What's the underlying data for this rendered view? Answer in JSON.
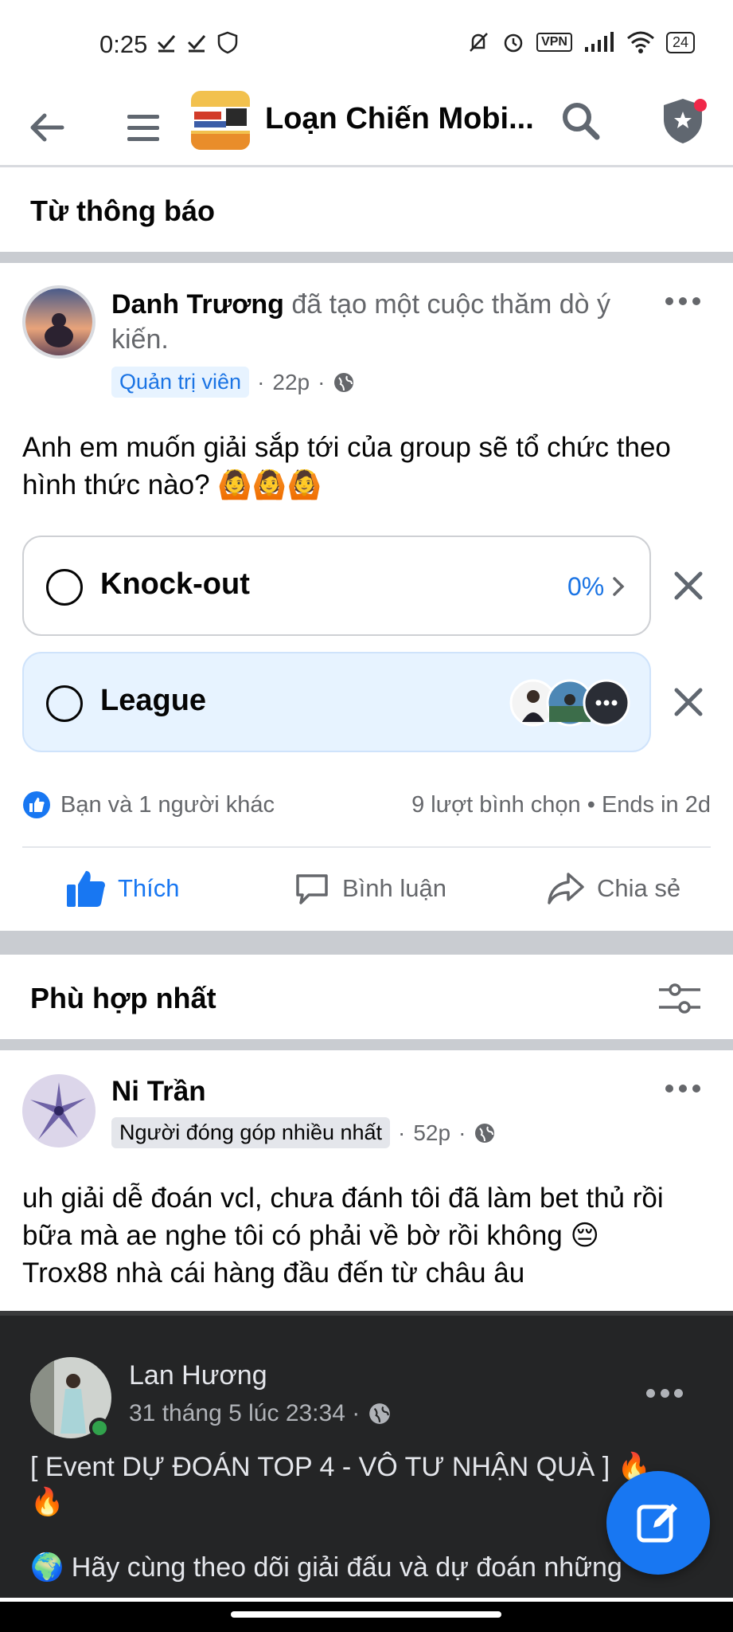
{
  "status_bar": {
    "time": "0:25",
    "vpn": "VPN",
    "battery": "24"
  },
  "navbar": {
    "title": "Loạn Chiến Mobi..."
  },
  "announcement": {
    "title": "Từ thông báo"
  },
  "poll_post": {
    "author": "Danh Trương",
    "action_text": "đã tạo một cuộc thăm dò ý kiến.",
    "role_badge": "Quản trị viên",
    "time": "22p",
    "question": "Anh em muốn giải sắp tới của group sẽ tổ chức theo hình thức nào?",
    "emojis": "🙆🙆🙆",
    "options": [
      {
        "label": "Knock-out",
        "percent": "0%"
      },
      {
        "label": "League",
        "voters_more": "..."
      }
    ],
    "reactions": "Bạn và 1 người khác",
    "votes": "9 lượt bình chọn • Ends in 2d",
    "actions": {
      "like": "Thích",
      "comment": "Bình luận",
      "share": "Chia sẻ"
    }
  },
  "relevant": {
    "title": "Phù hợp nhất"
  },
  "comment_post": {
    "author": "Ni Trần",
    "badge": "Người đóng góp nhiều nhất",
    "time": "52p",
    "line1": "uh giải dễ đoán vcl, chưa đánh tôi đã làm bet thủ rồi",
    "line2": "bữa mà ae nghe tôi có phải về bờ rồi không 😔",
    "line3": "Trox88 nhà cái hàng đầu đến từ châu âu"
  },
  "shared_post": {
    "author": "Lan Hương",
    "date": "31 tháng 5 lúc 23:34 ·",
    "line1": "[ Event DỰ ĐOÁN TOP 4 - VÔ TƯ NHẬN QUÀ ] 🔥",
    "line2": "🔥",
    "line3": "🌍 Hãy cùng theo dõi giải đấu và dự đoán những"
  },
  "colors": {
    "accent": "#1877f2",
    "poll_selected_bg": "#e7f3ff",
    "separator": "#c9ccd1"
  }
}
